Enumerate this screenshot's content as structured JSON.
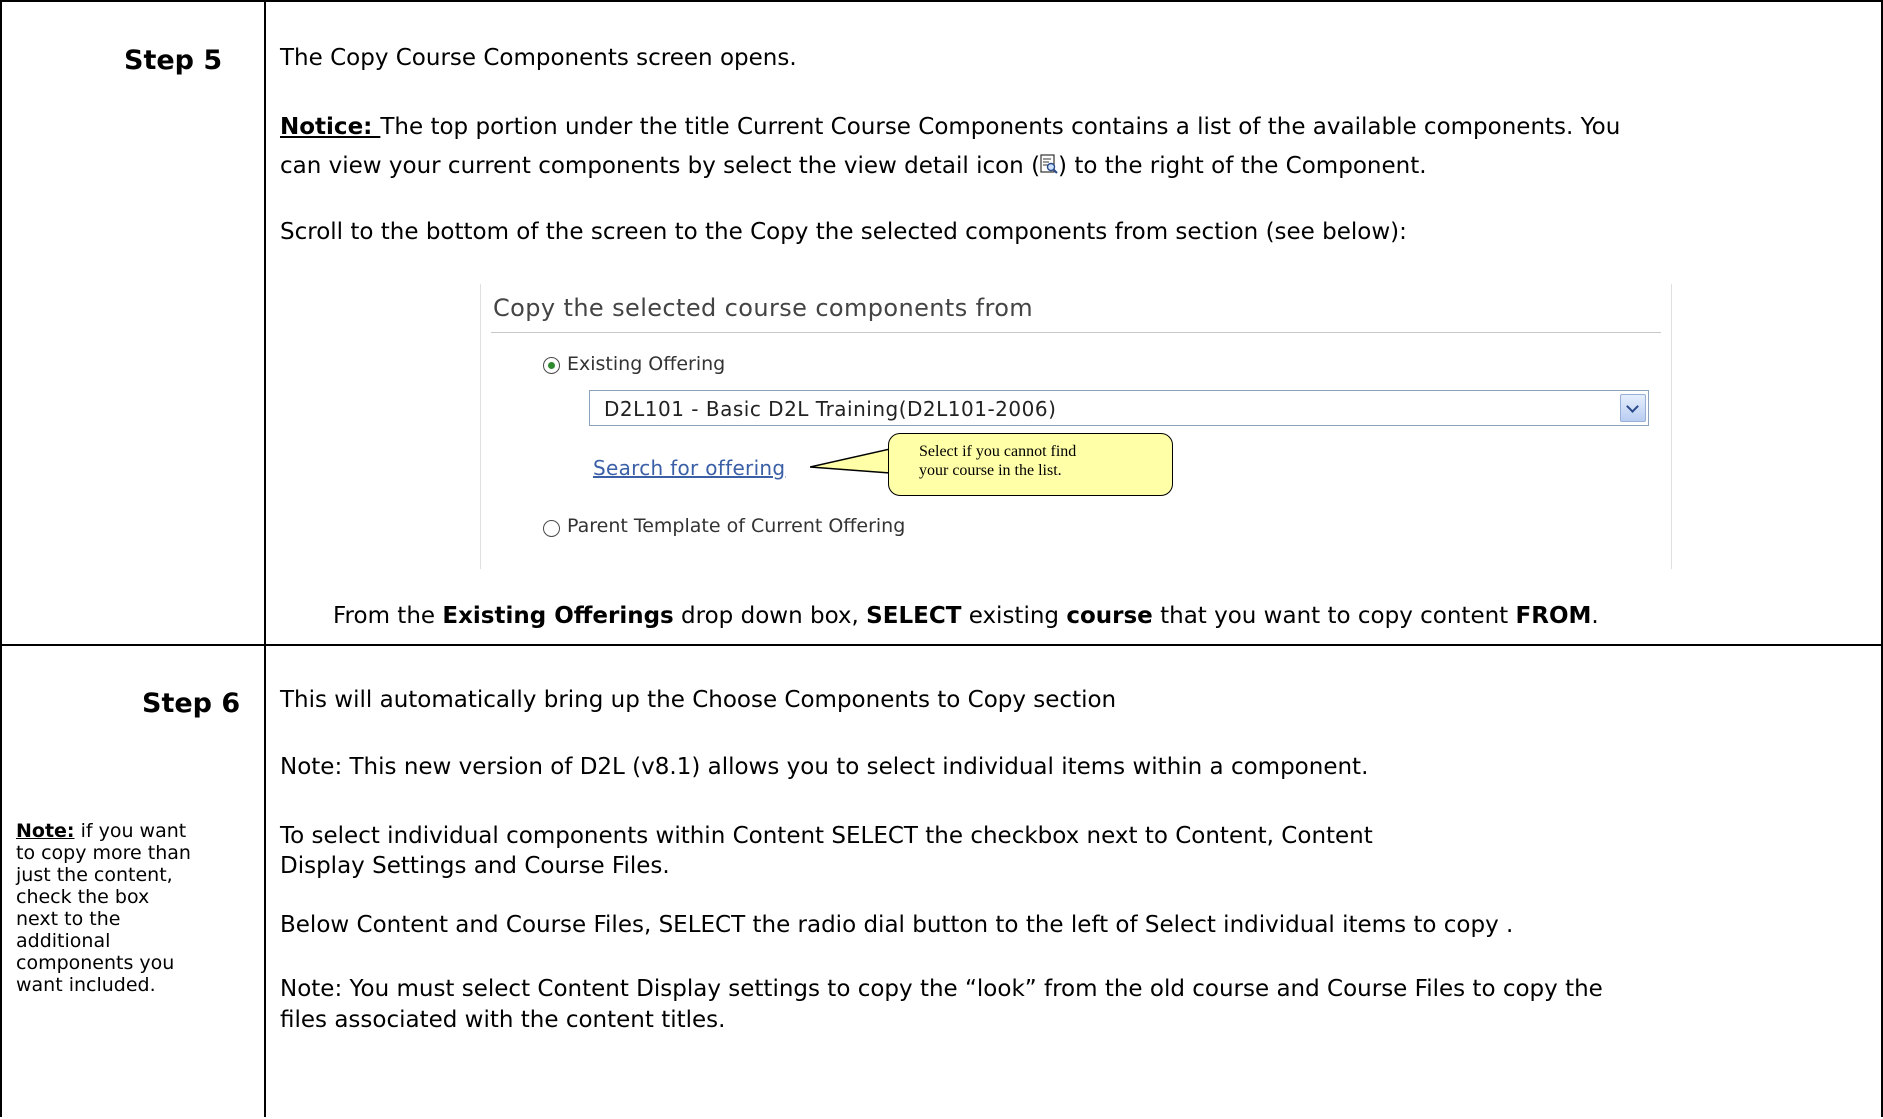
{
  "step5": {
    "label": "Step 5",
    "line1": "The Copy Course Components screen opens.",
    "notice_label": "Notice: ",
    "notice_text_a": "The top portion under the title Current Course Components contains a list of the available components.  You",
    "notice_text_b": "can view your current components by select the view detail icon (",
    "notice_text_c": ") to the right of the Component.",
    "scroll_text": "Scroll to the bottom of the screen to the Copy the selected components from section (see below):",
    "panel": {
      "title": "Copy the selected course components from",
      "radio1_label": "Existing Offering",
      "dropdown_value": "D2L101 - Basic D2L Training(D2L101-2006)",
      "search_link": "Search for offering",
      "callout_line1": "Select if you cannot find",
      "callout_line2": "your course in the list.",
      "radio2_label": "Parent Template of Current Offering"
    },
    "footer": {
      "p1": "From the ",
      "b1": "Existing Offerings",
      "p2": " drop down box, ",
      "b2": "SELECT",
      "p3": " existing ",
      "b3": "course",
      "p4": " that you want to copy content ",
      "b4": "FROM",
      "p5": "."
    }
  },
  "step6": {
    "label": "Step 6",
    "side_note_label": "Note:",
    "side_note_lines": [
      "if you want",
      "to copy more than",
      "just the content,",
      "check the box",
      "next to the",
      "additional",
      "components you",
      "want included."
    ],
    "line1": "This will automatically bring up the Choose Components to Copy section",
    "line2": "Note:  This new version of D2L (v8.1) allows you to select individual items within a component.",
    "line3a": "To select individual components within Content SELECT the checkbox next to Content, Content",
    "line3b": "Display Settings and Course Files.",
    "line4": "Below Content and Course Files, SELECT the radio dial button to the left of Select individual items to copy .",
    "line5a": "Note: You must select Content Display settings to copy the “look” from the old course and Course Files to copy the",
    "line5b": "files associated with the content titles."
  }
}
